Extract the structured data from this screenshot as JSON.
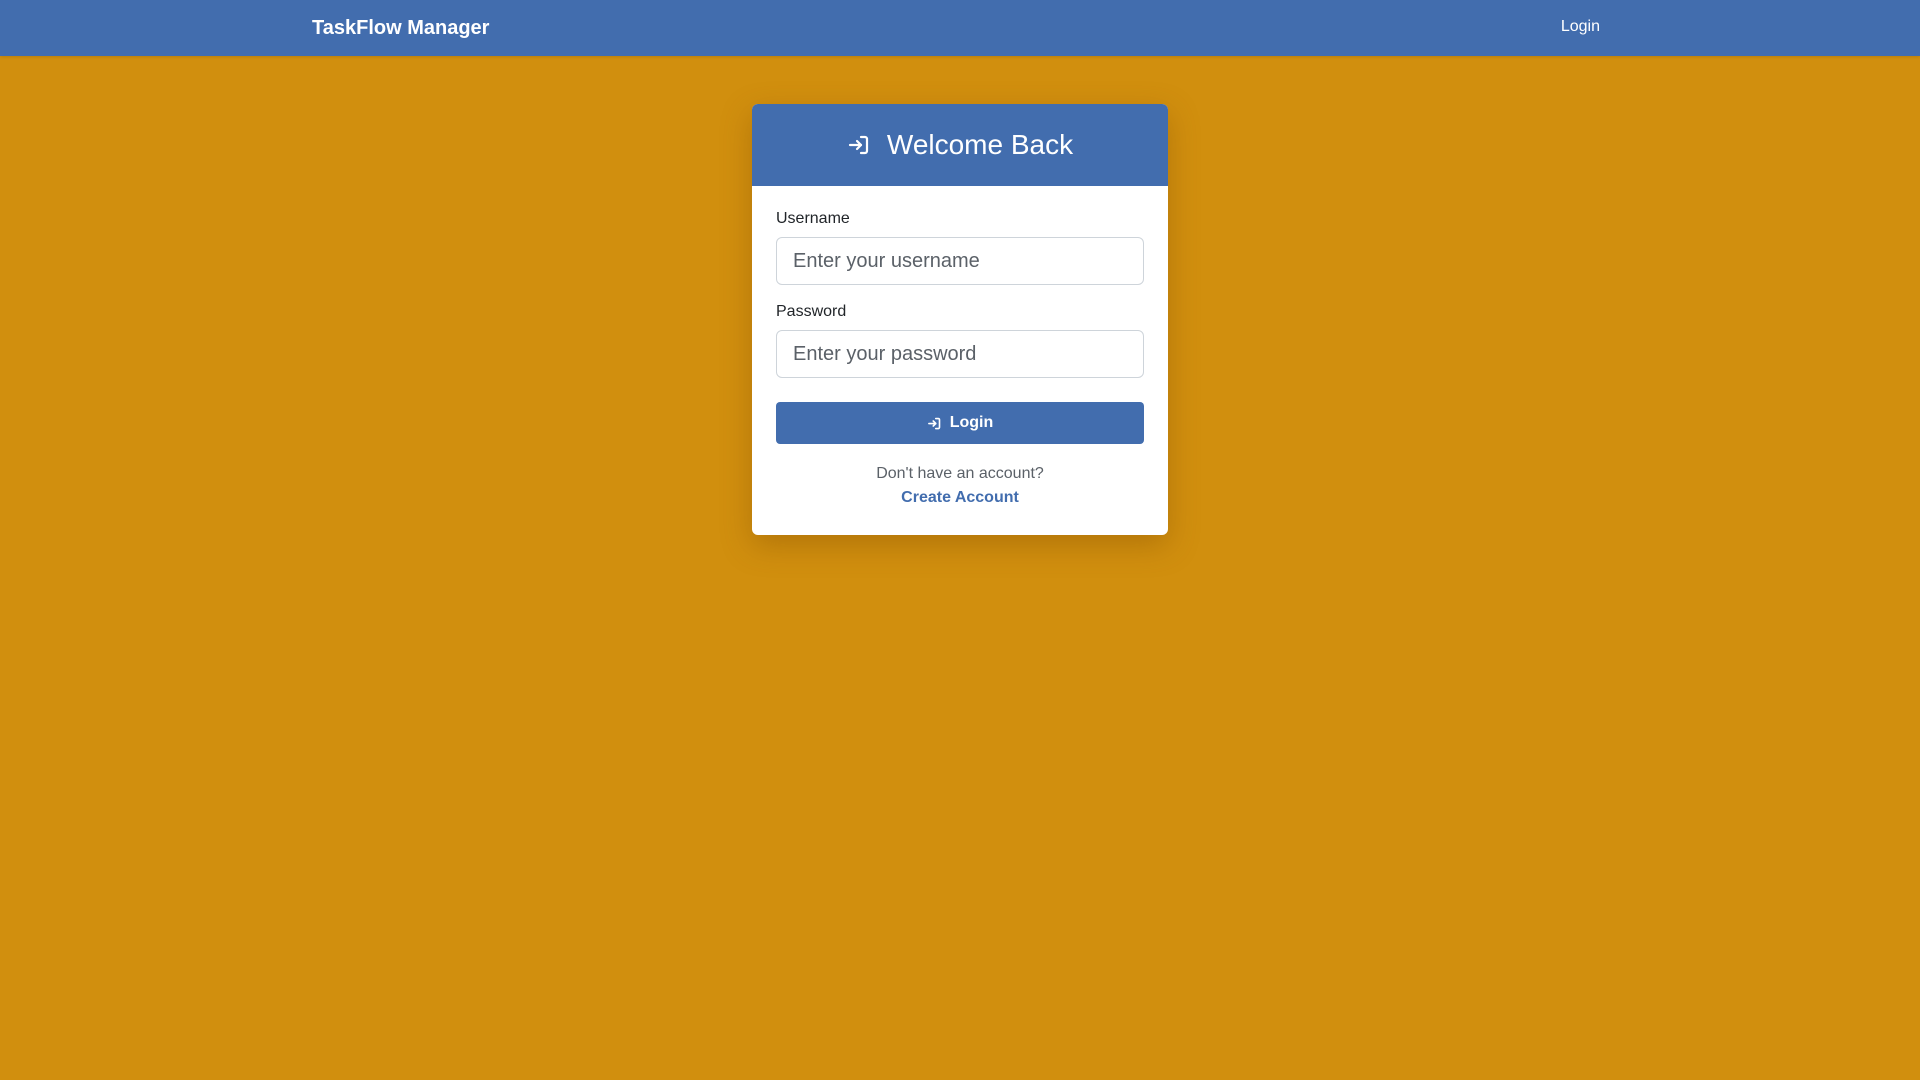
{
  "navbar": {
    "brand": "TaskFlow Manager",
    "login_link": "Login"
  },
  "login_card": {
    "header_icon": "sign-in-icon",
    "title": "Welcome Back",
    "username": {
      "label": "Username",
      "placeholder": "Enter your username",
      "value": ""
    },
    "password": {
      "label": "Password",
      "placeholder": "Enter your password",
      "value": ""
    },
    "submit": {
      "icon": "sign-in-icon",
      "label": "Login"
    },
    "footer": {
      "prompt": "Don't have an account?",
      "create_account": "Create Account"
    }
  },
  "colors": {
    "background": "#d18f0e",
    "primary": "#426dae",
    "card": "#ffffff"
  }
}
